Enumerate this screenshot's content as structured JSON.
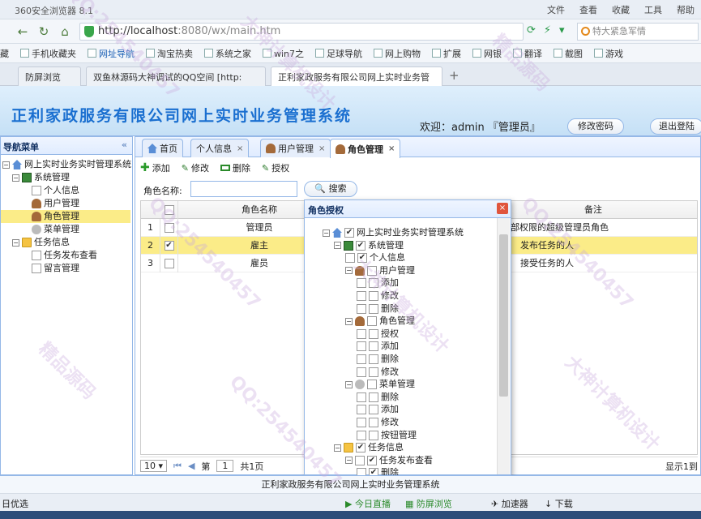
{
  "browser": {
    "title": "360安全浏览器 8.1",
    "menu": [
      "文件",
      "查看",
      "收藏",
      "工具",
      "帮助"
    ],
    "url_host": "http://localhost",
    "url_path": ":8080/wx/main.htm",
    "search_placeholder": "特大紧急军情",
    "favorites": [
      "藏",
      "手机收藏夹",
      "网址导航",
      "淘宝热卖",
      "系统之家",
      "win7之",
      "足球导航",
      "网上购物",
      "扩展",
      "网银",
      "翻译",
      "截图",
      "游戏"
    ],
    "tabs": [
      "防屏浏览",
      "双鱼林源码大神调试的QQ空间 [http:",
      "正利家政服务有限公司网上实时业务管"
    ]
  },
  "header": {
    "system_name": "正利家政服务有限公司网上实时业务管理系统",
    "welcome": "欢迎：admin 『管理员』",
    "change_pwd": "修改密码",
    "logout": "退出登陆"
  },
  "west": {
    "title": "导航菜单",
    "collapse": "«",
    "tree": {
      "root": "网上实时业务实时管理系统",
      "system": "系统管理",
      "sys_items": [
        "个人信息",
        "用户管理",
        "角色管理",
        "菜单管理"
      ],
      "task": "任务信息",
      "task_items": [
        "任务发布查看",
        "留言管理"
      ]
    }
  },
  "center": {
    "tabs": [
      "首页",
      "个人信息",
      "用户管理",
      "角色管理"
    ],
    "toolbar": [
      "添加",
      "修改",
      "删除",
      "授权"
    ],
    "filter_label": "角色名称:",
    "search_btn": "搜索",
    "grid": {
      "headers": [
        "角色名称",
        "备注"
      ],
      "rows": [
        {
          "num": "1",
          "name": "管理员",
          "note": "部权限的超级管理员角色",
          "checked": false
        },
        {
          "num": "2",
          "name": "雇主",
          "note": "发布任务的人",
          "checked": true
        },
        {
          "num": "3",
          "name": "雇员",
          "note": "接受任务的人",
          "checked": false
        }
      ]
    },
    "pager": {
      "size": "10",
      "page_label": "第",
      "page": "1",
      "total": "共1页",
      "display": "显示1到"
    }
  },
  "dialog": {
    "title": "角色授权",
    "close": "×",
    "tree": [
      {
        "label": "网上实时业务实时管理系统",
        "checked": true,
        "level": 0,
        "exp": "−",
        "icon": "home"
      },
      {
        "label": "系统管理",
        "checked": true,
        "level": 1,
        "exp": "−",
        "icon": "sys"
      },
      {
        "label": "个人信息",
        "checked": true,
        "level": 2,
        "exp": "",
        "icon": "doc"
      },
      {
        "label": "用户管理",
        "checked": false,
        "level": 2,
        "exp": "−",
        "icon": "user"
      },
      {
        "label": "添加",
        "checked": false,
        "level": 3,
        "exp": "",
        "icon": "doc"
      },
      {
        "label": "修改",
        "checked": false,
        "level": 3,
        "exp": "",
        "icon": "doc"
      },
      {
        "label": "删除",
        "checked": false,
        "level": 3,
        "exp": "",
        "icon": "doc"
      },
      {
        "label": "角色管理",
        "checked": false,
        "level": 2,
        "exp": "−",
        "icon": "user"
      },
      {
        "label": "授权",
        "checked": false,
        "level": 3,
        "exp": "",
        "icon": "doc"
      },
      {
        "label": "添加",
        "checked": false,
        "level": 3,
        "exp": "",
        "icon": "doc"
      },
      {
        "label": "删除",
        "checked": false,
        "level": 3,
        "exp": "",
        "icon": "doc"
      },
      {
        "label": "修改",
        "checked": false,
        "level": 3,
        "exp": "",
        "icon": "doc"
      },
      {
        "label": "菜单管理",
        "checked": false,
        "level": 2,
        "exp": "−",
        "icon": "menu"
      },
      {
        "label": "删除",
        "checked": false,
        "level": 3,
        "exp": "",
        "icon": "doc"
      },
      {
        "label": "添加",
        "checked": false,
        "level": 3,
        "exp": "",
        "icon": "doc"
      },
      {
        "label": "修改",
        "checked": false,
        "level": 3,
        "exp": "",
        "icon": "doc"
      },
      {
        "label": "按钮管理",
        "checked": false,
        "level": 3,
        "exp": "",
        "icon": "doc"
      },
      {
        "label": "任务信息",
        "checked": true,
        "level": 1,
        "exp": "−",
        "icon": "folder"
      },
      {
        "label": "任务发布查看",
        "checked": true,
        "level": 2,
        "exp": "−",
        "icon": "doc"
      },
      {
        "label": "删除",
        "checked": true,
        "level": 3,
        "exp": "",
        "icon": "doc"
      }
    ]
  },
  "footer": "正利家政服务有限公司网上实时业务管理系统",
  "status": {
    "left": "日优选",
    "items": [
      "今日直播",
      "防屏浏览",
      "加速器",
      "下载"
    ]
  },
  "watermarks": [
    "QQ:254540457",
    "大神计算机设计",
    "精品源码",
    "QQ:254540457",
    "大神计算机设计",
    "QQ:254540457",
    "精品源码",
    "QQ:254540457",
    "大神计算机设计"
  ]
}
